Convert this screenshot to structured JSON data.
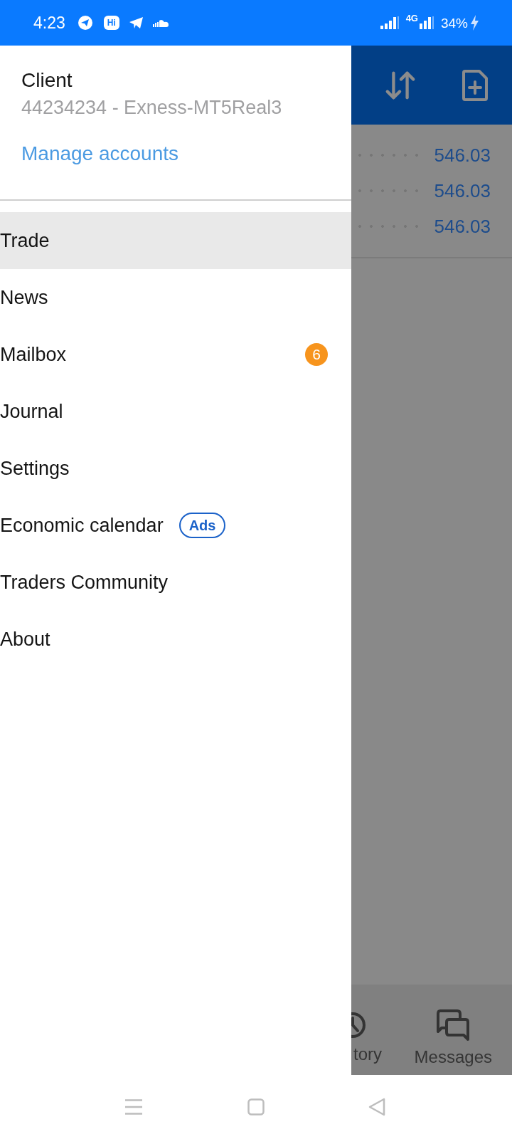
{
  "status_bar": {
    "time": "4:23",
    "app_icon_label": "Hi",
    "network": "4G",
    "battery": "34%",
    "charging": true
  },
  "drawer": {
    "account_name": "Client",
    "account_number": "44234234 - Exness-MT5Real3",
    "manage_link": "Manage accounts",
    "items": [
      {
        "label": "Trade",
        "selected": true
      },
      {
        "label": "News",
        "selected": false
      },
      {
        "label": "Mailbox",
        "selected": false,
        "badge": "6"
      },
      {
        "label": "Journal",
        "selected": false
      },
      {
        "label": "Settings",
        "selected": false
      },
      {
        "label": "Economic calendar",
        "selected": false,
        "tag": "Ads"
      },
      {
        "label": "Traders Community",
        "selected": false
      },
      {
        "label": "About",
        "selected": false
      }
    ]
  },
  "background_screen": {
    "prices": [
      "546.03",
      "546.03",
      "546.03"
    ],
    "bottom_tabs": [
      {
        "label": "tory"
      },
      {
        "label": "Messages"
      }
    ]
  }
}
